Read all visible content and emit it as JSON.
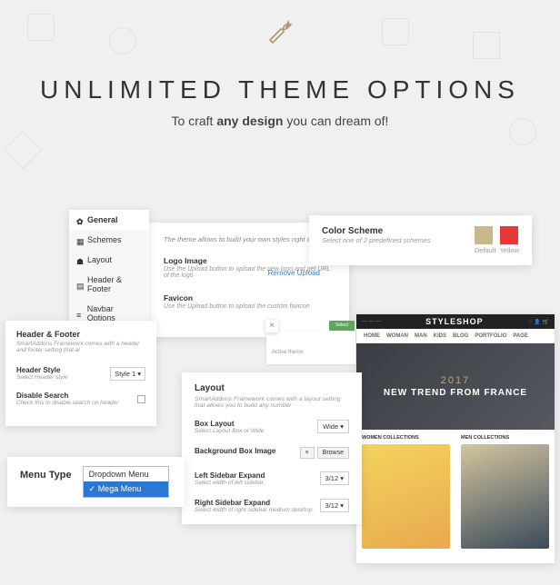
{
  "hero": {
    "title": "UNLIMITED THEME OPTIONS",
    "subtitle_pre": "To craft ",
    "subtitle_bold": "any design",
    "subtitle_post": " you can dream of!"
  },
  "sidenav": {
    "items": [
      {
        "label": "General",
        "icon": "gear"
      },
      {
        "label": "Schemes",
        "icon": "grid"
      },
      {
        "label": "Layout",
        "icon": "speech"
      },
      {
        "label": "Header & Footer",
        "icon": "layout"
      },
      {
        "label": "Navbar Options",
        "icon": "menu"
      }
    ]
  },
  "general": {
    "intro": "The theme allows to build your own styles right out of t",
    "logo_label": "Logo Image",
    "logo_hint": "Use the Upload button to upload the new logo and get URL of the logo",
    "remove_link": "Remove Upload",
    "favicon_label": "Favicon",
    "favicon_hint": "Use the Upload button to upload the custom favicon"
  },
  "colorscheme": {
    "label": "Color Scheme",
    "hint": "Select one of 2 predefined schemes",
    "swatches": [
      {
        "name": "Default",
        "color": "#c8b88a"
      },
      {
        "name": "Yellow",
        "color": "#e53935"
      }
    ]
  },
  "headerfooter": {
    "title": "Header & Footer",
    "hint": "SmartAddons Framework comes with a header and footer setting that al",
    "style_label": "Header Style",
    "style_hint": "Select Header style",
    "style_value": "Style 1  ▾",
    "disable_label": "Disable Search",
    "disable_hint": "Check this to disable search on header"
  },
  "layout": {
    "title": "Layout",
    "hint": "SmartAddons Framework comes with a layout setting that allows you to build any number",
    "box_label": "Box Layout",
    "box_hint": "Select Layout Box or Wide",
    "box_value": "Wide  ▾",
    "bg_label": "Background Box Image",
    "bg_btn1": "×",
    "bg_btn2": "Browse",
    "left_label": "Left Sidebar Expand",
    "left_hint": "Select width of left sidebar.",
    "left_value": "3/12  ▾",
    "right_label": "Right Sidebar Expand",
    "right_hint": "Select width of right sidebar medium desktop.",
    "right_value": "3/12  ▾"
  },
  "menutype": {
    "label": "Menu Type",
    "options": [
      "Dropdown Menu",
      "Mega Menu"
    ],
    "selected": 1
  },
  "dialog": {
    "close": "×",
    "select": "Select",
    "active_theme": "Active theme"
  },
  "preview": {
    "brand": "STYLESHOP",
    "nav": [
      "HOME",
      "WOMAN",
      "MAN",
      "KIDS",
      "BLOG",
      "PORTFOLIO",
      "PAGE"
    ],
    "year": "2017",
    "slogan": "NEW TREND FROM FRANCE",
    "col1_title": "WOMEN COLLECTIONS",
    "col2_title": "MEN COLLECTIONS"
  }
}
